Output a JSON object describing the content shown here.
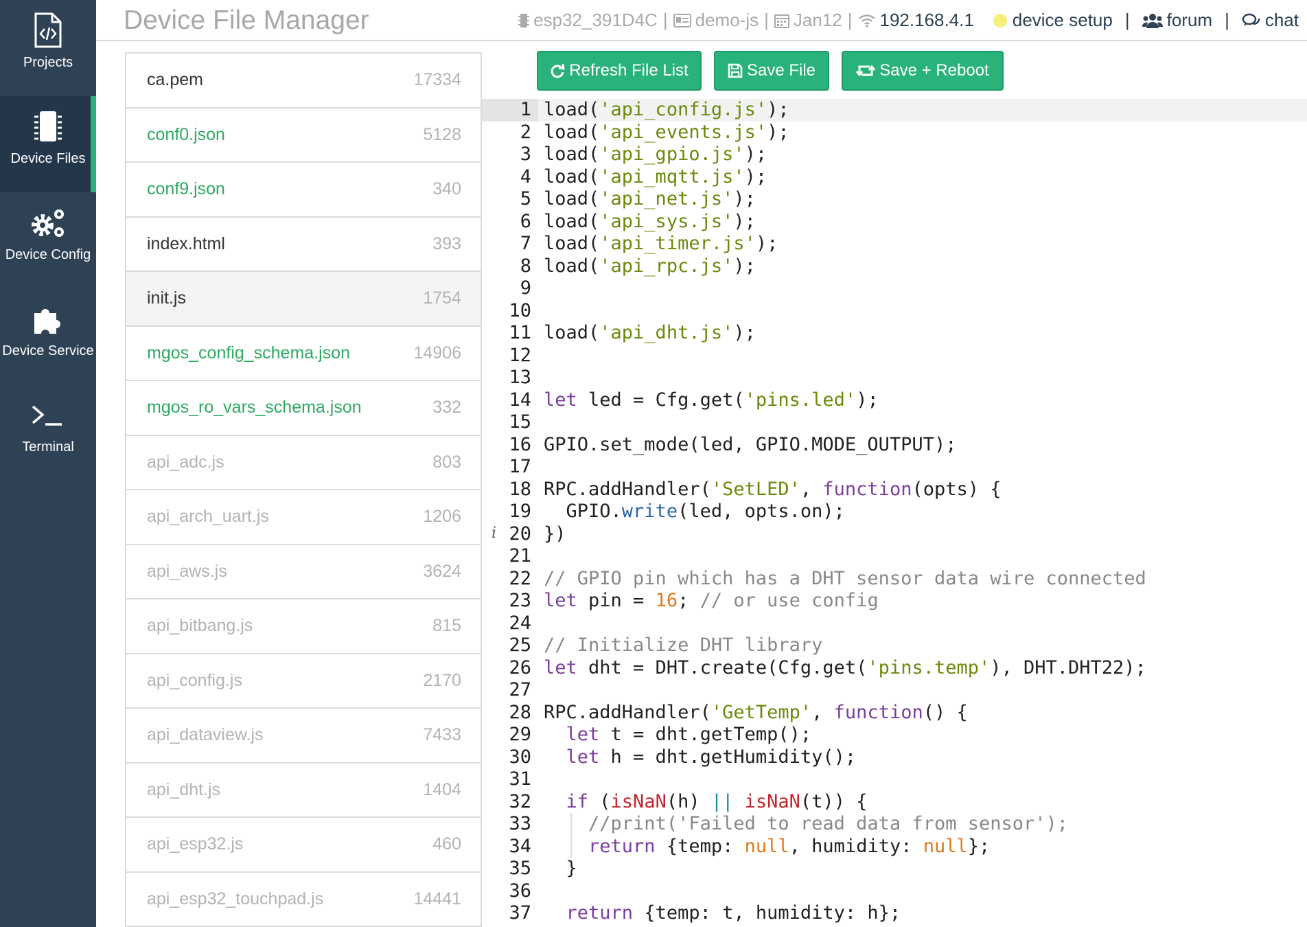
{
  "sidebar": {
    "items": [
      {
        "label": "Projects",
        "icon": "code-file-icon",
        "active": false
      },
      {
        "label": "Device Files",
        "icon": "chip-icon",
        "active": true
      },
      {
        "label": "Device Config",
        "icon": "gears-icon",
        "active": false
      },
      {
        "label": "Device Service",
        "icon": "puzzle-icon",
        "active": false
      },
      {
        "label": "Terminal",
        "icon": "terminal-icon",
        "active": false
      }
    ]
  },
  "header": {
    "title": "Device File Manager",
    "device_id": "esp32_391D4C",
    "app_name": "demo-js",
    "date": "Jan12",
    "ip": "192.168.4.1",
    "sep": "|",
    "setup_label": "device setup",
    "forum_label": "forum",
    "chat_label": "chat"
  },
  "toolbar": {
    "refresh_label": "Refresh File List",
    "save_label": "Save File",
    "save_reboot_label": "Save + Reboot"
  },
  "files": [
    {
      "name": "ca.pem",
      "size": "17334",
      "kind": "plain"
    },
    {
      "name": "conf0.json",
      "size": "5128",
      "kind": "config"
    },
    {
      "name": "conf9.json",
      "size": "340",
      "kind": "config"
    },
    {
      "name": "index.html",
      "size": "393",
      "kind": "plain"
    },
    {
      "name": "init.js",
      "size": "1754",
      "kind": "plain",
      "selected": true
    },
    {
      "name": "mgos_config_schema.json",
      "size": "14906",
      "kind": "config"
    },
    {
      "name": "mgos_ro_vars_schema.json",
      "size": "332",
      "kind": "config"
    },
    {
      "name": "api_adc.js",
      "size": "803",
      "kind": "lib"
    },
    {
      "name": "api_arch_uart.js",
      "size": "1206",
      "kind": "lib"
    },
    {
      "name": "api_aws.js",
      "size": "3624",
      "kind": "lib"
    },
    {
      "name": "api_bitbang.js",
      "size": "815",
      "kind": "lib"
    },
    {
      "name": "api_config.js",
      "size": "2170",
      "kind": "lib"
    },
    {
      "name": "api_dataview.js",
      "size": "7433",
      "kind": "lib"
    },
    {
      "name": "api_dht.js",
      "size": "1404",
      "kind": "lib"
    },
    {
      "name": "api_esp32.js",
      "size": "460",
      "kind": "lib"
    },
    {
      "name": "api_esp32_touchpad.js",
      "size": "14441",
      "kind": "lib"
    }
  ],
  "editor": {
    "info_marker": "i",
    "info_line": 20,
    "lines": [
      [
        [
          "plain",
          "load("
        ],
        [
          "str",
          "'api_config.js'"
        ],
        [
          "plain",
          ");"
        ]
      ],
      [
        [
          "plain",
          "load("
        ],
        [
          "str",
          "'api_events.js'"
        ],
        [
          "plain",
          ");"
        ]
      ],
      [
        [
          "plain",
          "load("
        ],
        [
          "str",
          "'api_gpio.js'"
        ],
        [
          "plain",
          ");"
        ]
      ],
      [
        [
          "plain",
          "load("
        ],
        [
          "str",
          "'api_mqtt.js'"
        ],
        [
          "plain",
          ");"
        ]
      ],
      [
        [
          "plain",
          "load("
        ],
        [
          "str",
          "'api_net.js'"
        ],
        [
          "plain",
          ");"
        ]
      ],
      [
        [
          "plain",
          "load("
        ],
        [
          "str",
          "'api_sys.js'"
        ],
        [
          "plain",
          ");"
        ]
      ],
      [
        [
          "plain",
          "load("
        ],
        [
          "str",
          "'api_timer.js'"
        ],
        [
          "plain",
          ");"
        ]
      ],
      [
        [
          "plain",
          "load("
        ],
        [
          "str",
          "'api_rpc.js'"
        ],
        [
          "plain",
          ");"
        ]
      ],
      [],
      [],
      [
        [
          "plain",
          "load("
        ],
        [
          "str",
          "'api_dht.js'"
        ],
        [
          "plain",
          ");"
        ]
      ],
      [],
      [],
      [
        [
          "kw",
          "let"
        ],
        [
          "plain",
          " led = Cfg.get("
        ],
        [
          "str",
          "'pins.led'"
        ],
        [
          "plain",
          ");"
        ]
      ],
      [],
      [
        [
          "plain",
          "GPIO.set_mode(led, GPIO.MODE_OUTPUT);"
        ]
      ],
      [],
      [
        [
          "plain",
          "RPC.addHandler("
        ],
        [
          "str",
          "'SetLED'"
        ],
        [
          "plain",
          ", "
        ],
        [
          "kw",
          "function"
        ],
        [
          "plain",
          "(opts) {"
        ]
      ],
      [
        [
          "plain",
          "  GPIO."
        ],
        [
          "meth",
          "write"
        ],
        [
          "plain",
          "(led, opts.on);"
        ]
      ],
      [
        [
          "plain",
          "})"
        ]
      ],
      [],
      [
        [
          "com",
          "// GPIO pin which has a DHT sensor data wire connected"
        ]
      ],
      [
        [
          "kw",
          "let"
        ],
        [
          "plain",
          " pin = "
        ],
        [
          "num",
          "16"
        ],
        [
          "plain",
          "; "
        ],
        [
          "com",
          "// or use config"
        ]
      ],
      [],
      [
        [
          "com",
          "// Initialize DHT library"
        ]
      ],
      [
        [
          "kw",
          "let"
        ],
        [
          "plain",
          " dht = DHT.create(Cfg.get("
        ],
        [
          "str",
          "'pins.temp'"
        ],
        [
          "plain",
          "), DHT.DHT22);"
        ]
      ],
      [],
      [
        [
          "plain",
          "RPC.addHandler("
        ],
        [
          "str",
          "'GetTemp'"
        ],
        [
          "plain",
          ", "
        ],
        [
          "kw",
          "function"
        ],
        [
          "plain",
          "() {"
        ]
      ],
      [
        [
          "plain",
          "  "
        ],
        [
          "kw",
          "let"
        ],
        [
          "plain",
          " t = dht.getTemp();"
        ]
      ],
      [
        [
          "plain",
          "  "
        ],
        [
          "kw",
          "let"
        ],
        [
          "plain",
          " h = dht.getHumidity();"
        ]
      ],
      [],
      [
        [
          "plain",
          "  "
        ],
        [
          "kw",
          "if"
        ],
        [
          "plain",
          " ("
        ],
        [
          "builtin",
          "isNaN"
        ],
        [
          "plain",
          "(h) "
        ],
        [
          "op",
          "||"
        ],
        [
          "plain",
          " "
        ],
        [
          "builtin",
          "isNaN"
        ],
        [
          "plain",
          "(t)) {"
        ]
      ],
      [
        [
          "plain",
          "    "
        ],
        [
          "com",
          "//print('Failed to read data from sensor');"
        ]
      ],
      [
        [
          "plain",
          "    "
        ],
        [
          "kw",
          "return"
        ],
        [
          "plain",
          " {temp: "
        ],
        [
          "num",
          "null"
        ],
        [
          "plain",
          ", humidity: "
        ],
        [
          "num",
          "null"
        ],
        [
          "plain",
          "};"
        ]
      ],
      [
        [
          "plain",
          "  }"
        ]
      ],
      [],
      [
        [
          "plain",
          "  "
        ],
        [
          "kw",
          "return"
        ],
        [
          "plain",
          " {temp: t, humidity: h};"
        ]
      ]
    ]
  }
}
